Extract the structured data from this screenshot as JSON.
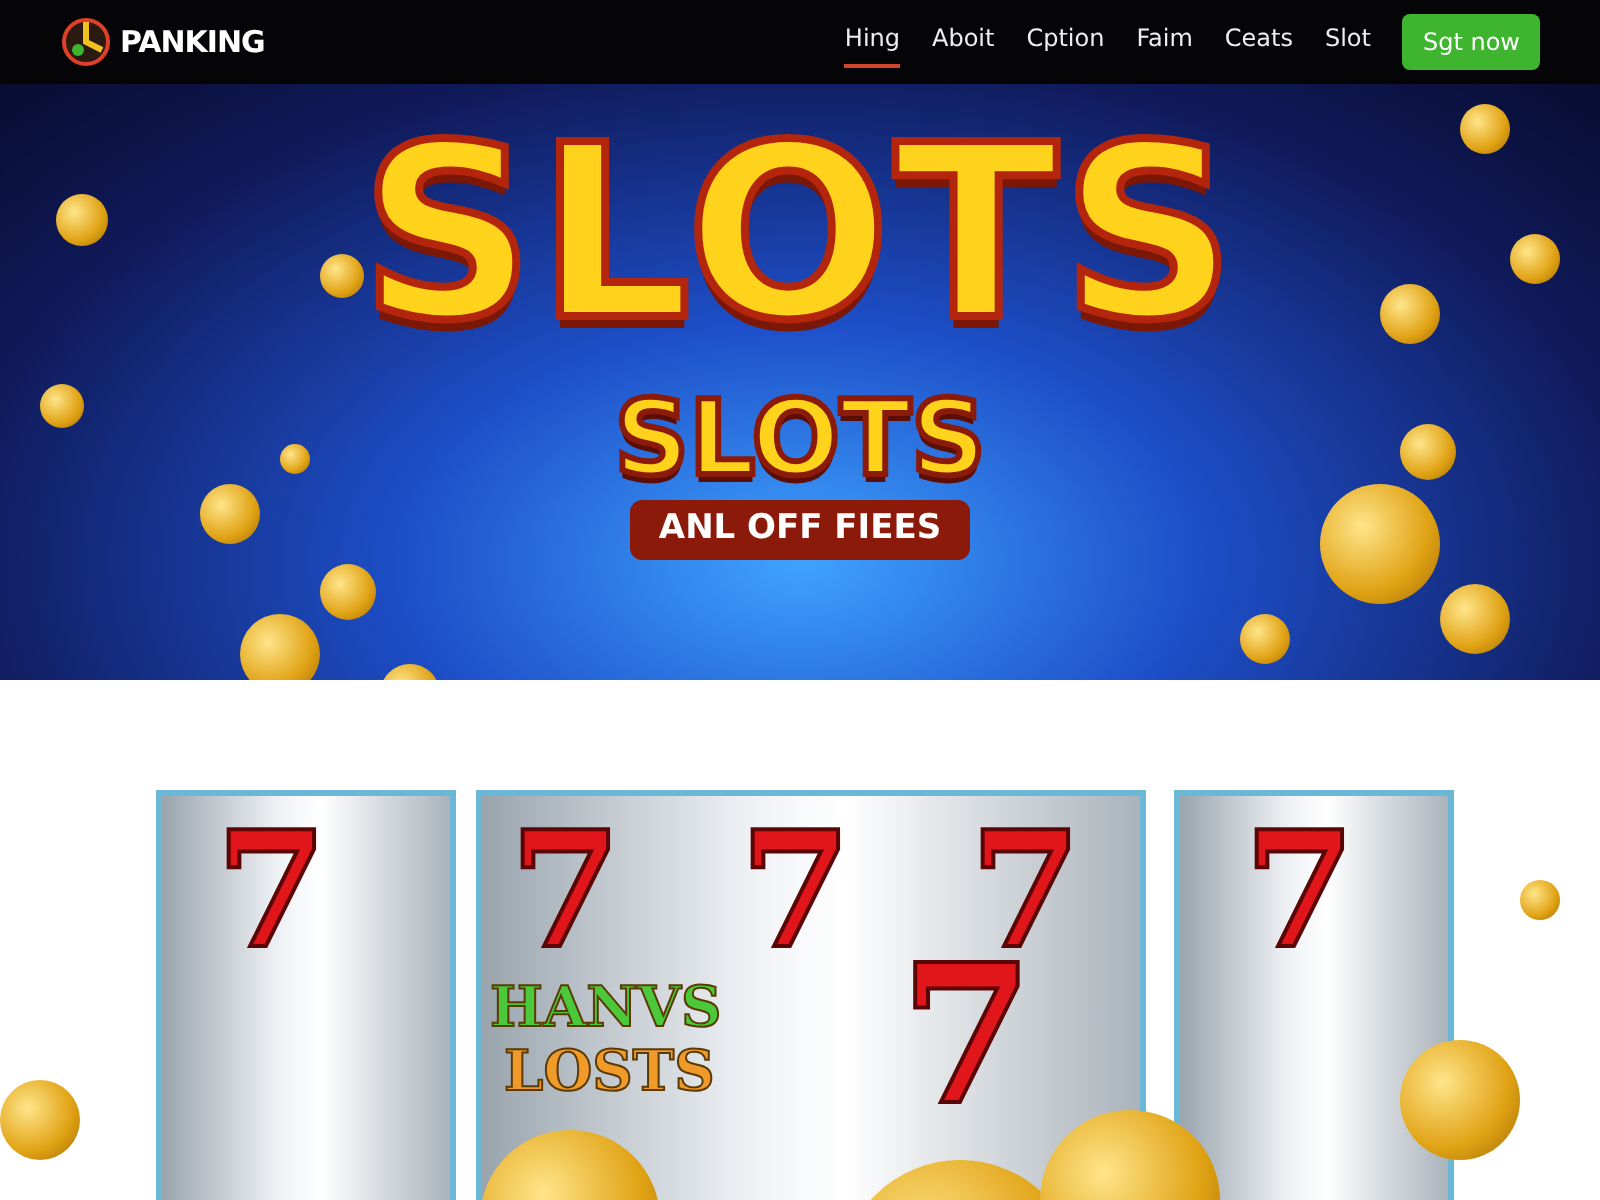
{
  "brand": {
    "name": "PANKING"
  },
  "nav": {
    "links": [
      {
        "label": "Hing",
        "selected": true
      },
      {
        "label": "Aboit",
        "selected": false
      },
      {
        "label": "Cption",
        "selected": false
      },
      {
        "label": "Faim",
        "selected": false
      },
      {
        "label": "Ceats",
        "selected": false
      },
      {
        "label": "Slot",
        "selected": false
      }
    ],
    "cta": "Sgt now"
  },
  "hero": {
    "title": "SLOTS",
    "subtitle": "SLOTS",
    "caption": "ANL OFF FIEES"
  },
  "reels": [
    {
      "symbol": "7"
    },
    {
      "symbol": "7"
    },
    {
      "symbol": "7"
    },
    {
      "symbol": "7"
    },
    {
      "symbol": "7"
    }
  ],
  "sign": {
    "line_1": "HANVS",
    "line_2": "LOSTS"
  },
  "jackpot_symbol": "7"
}
